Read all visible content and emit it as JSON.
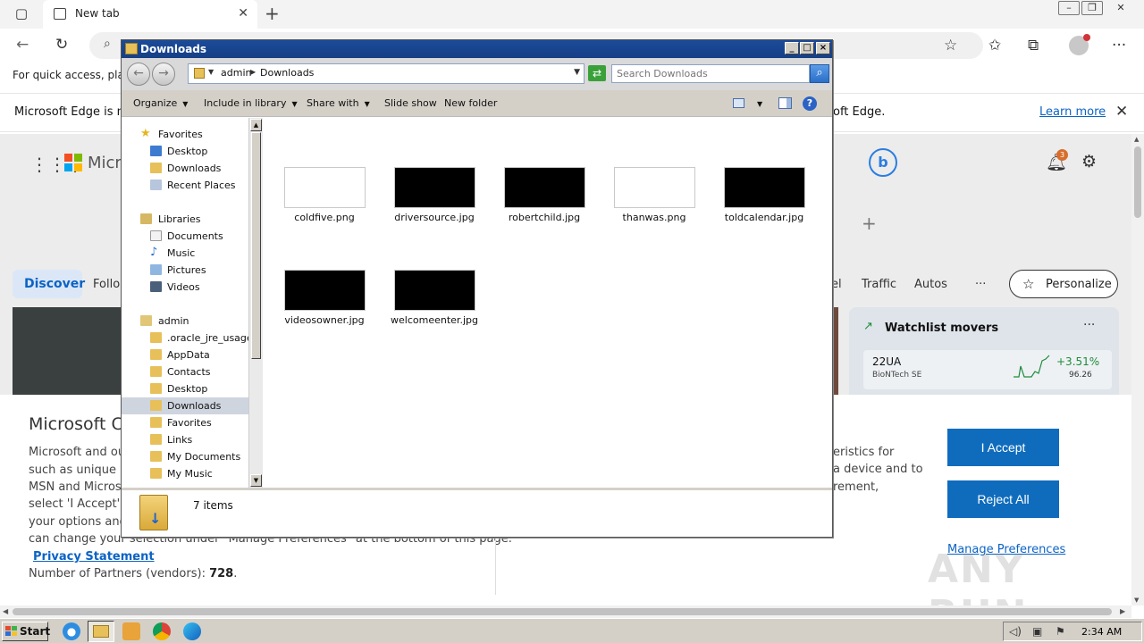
{
  "browser": {
    "tab_title": "New tab",
    "tab_close": "✕",
    "new_tab": "+",
    "favbar_text": "For quick access, place",
    "infobar_left": "Microsoft Edge is no",
    "infobar_right": "oft Edge.",
    "learn_more": "Learn more",
    "close": "✕"
  },
  "newtab": {
    "brand_partial": "Micro",
    "bing": "b",
    "notifications_count": "3",
    "feed_tabs": {
      "discover": "Discover",
      "following_partial": "Follo",
      "travel_partial": "el",
      "traffic": "Traffic",
      "autos": "Autos",
      "more": "···",
      "personalize": "Personalize"
    },
    "watchlist": {
      "title": "Watchlist movers",
      "more": "···",
      "symbol": "22UA",
      "name": "BioNTech SE",
      "change": "+3.51%",
      "price": "96.26"
    }
  },
  "consent": {
    "title": "Microsoft C",
    "lines": [
      "Microsoft and ou",
      "such as unique ID",
      "MSN and Microso",
      "select 'I Accept' to",
      "your options and",
      "can change your selection under \"Manage Preferences\" at the bottom of this page."
    ],
    "right_lines": [
      "eristics for",
      "a device and to",
      "rement,"
    ],
    "privacy": "Privacy Statement",
    "privacy_suffix": ".",
    "partners_label": "Number of Partners (vendors): ",
    "partners_count": "728",
    "partners_suffix": ".",
    "accept": "I Accept",
    "reject": "Reject All",
    "manage": "Manage Preferences",
    "watermark": "ANY RUN"
  },
  "explorer": {
    "title": "Downloads",
    "breadcrumb": [
      "admin",
      "Downloads"
    ],
    "search_placeholder": "Search Downloads",
    "toolbar": {
      "organize": "Organize",
      "include": "Include in library",
      "share": "Share with",
      "slideshow": "Slide show",
      "new_folder": "New folder"
    },
    "nav": {
      "favorites": "Favorites",
      "desktop": "Desktop",
      "downloads": "Downloads",
      "recent": "Recent Places",
      "libraries": "Libraries",
      "documents": "Documents",
      "music": "Music",
      "pictures": "Pictures",
      "videos": "Videos",
      "admin": "admin",
      "oracle": ".oracle_jre_usage",
      "appdata": "AppData",
      "contacts": "Contacts",
      "desktop2": "Desktop",
      "downloads2": "Downloads",
      "favorites2": "Favorites",
      "links": "Links",
      "mydocs": "My Documents",
      "mymusic": "My Music"
    },
    "files": [
      {
        "name": "coldfive.png",
        "thumb": "light"
      },
      {
        "name": "driversource.jpg",
        "thumb": "dark"
      },
      {
        "name": "robertchild.jpg",
        "thumb": "dark"
      },
      {
        "name": "thanwas.png",
        "thumb": "light"
      },
      {
        "name": "toldcalendar.jpg",
        "thumb": "dark"
      },
      {
        "name": "videosowner.jpg",
        "thumb": "dark"
      },
      {
        "name": "welcomeenter.jpg",
        "thumb": "dark"
      }
    ],
    "item_count": "7 items"
  },
  "taskbar": {
    "start": "Start",
    "clock": "2:34 AM"
  }
}
